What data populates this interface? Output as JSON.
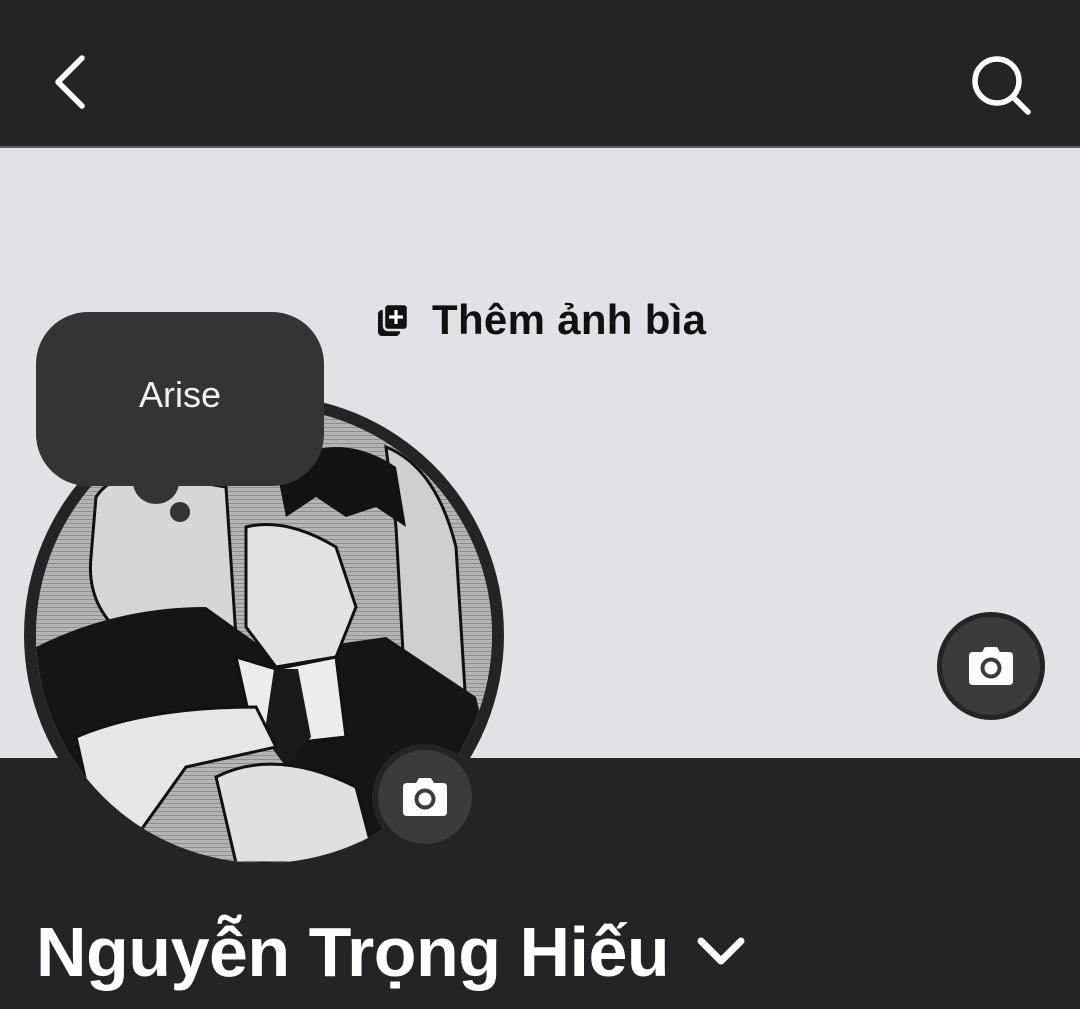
{
  "header": {
    "back_icon": "chevron-left-icon",
    "search_icon": "search-icon"
  },
  "cover": {
    "add_cover_label": "Thêm ảnh bìa",
    "add_cover_icon": "add-photo-icon",
    "camera_icon": "camera-icon"
  },
  "note": {
    "text": "Arise"
  },
  "avatar": {
    "camera_icon": "camera-icon"
  },
  "profile": {
    "name": "Nguyễn Trọng Hiếu",
    "dropdown_icon": "chevron-down-icon"
  },
  "colors": {
    "header_bg": "#242428",
    "cover_bg": "#dfe3e8",
    "button_bg": "#3a3b3f",
    "text_light": "#ffffff",
    "text_dark": "#111111"
  }
}
